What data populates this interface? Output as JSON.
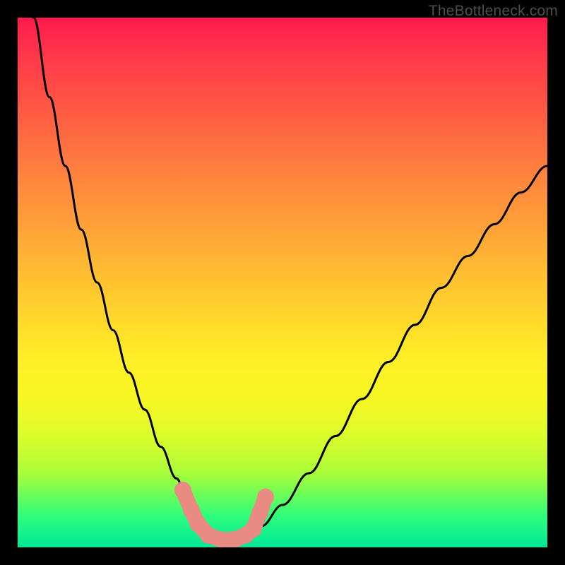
{
  "watermark": "TheBottleneck.com",
  "chart_data": {
    "type": "line",
    "title": "",
    "xlabel": "",
    "ylabel": "",
    "xlim": [
      0,
      100
    ],
    "ylim": [
      0,
      100
    ],
    "series": [
      {
        "name": "bottleneck-curve",
        "x": [
          0,
          3,
          6,
          9,
          12,
          15,
          18,
          21,
          24,
          27,
          30,
          32,
          34,
          36,
          38,
          40,
          42,
          44,
          46,
          50,
          55,
          60,
          65,
          70,
          75,
          80,
          85,
          90,
          95,
          100
        ],
        "values": [
          118,
          100,
          85,
          72,
          60,
          50,
          41,
          33,
          26,
          19,
          13,
          9,
          6,
          3.5,
          2,
          1.5,
          1.7,
          2.5,
          4,
          8,
          14,
          21,
          28,
          35,
          42,
          49,
          55,
          61,
          67,
          72
        ]
      }
    ],
    "markers": {
      "name": "highlighted-points",
      "color": "#e98b82",
      "points": [
        {
          "x": 31.2,
          "y": 10.8
        },
        {
          "x": 32.8,
          "y": 7.0
        },
        {
          "x": 34.0,
          "y": 4.5
        },
        {
          "x": 36.0,
          "y": 2.3
        },
        {
          "x": 38.5,
          "y": 1.4
        },
        {
          "x": 41.0,
          "y": 1.5
        },
        {
          "x": 43.0,
          "y": 2.3
        },
        {
          "x": 44.5,
          "y": 3.5
        },
        {
          "x": 45.7,
          "y": 6.5
        },
        {
          "x": 46.8,
          "y": 9.5
        }
      ]
    },
    "background_gradient": {
      "top": "#ff1a4d",
      "mid_upper": "#ffa338",
      "mid": "#ffee26",
      "mid_lower": "#a8fd3a",
      "bottom": "#00e897"
    }
  }
}
